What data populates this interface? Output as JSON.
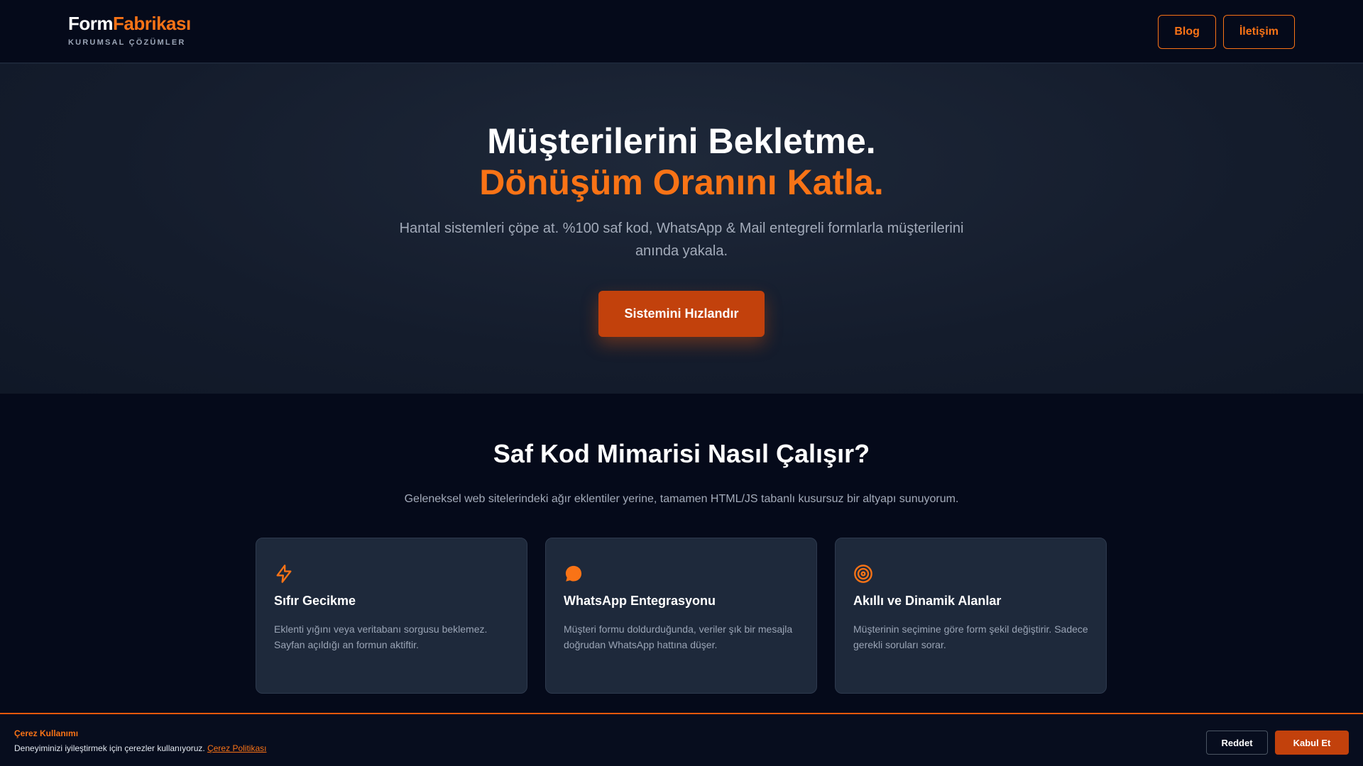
{
  "header": {
    "brand_part1": "Form",
    "brand_part2": "Fabrikası",
    "brand_tagline": "KURUMSAL ÇÖZÜMLER",
    "nav": [
      {
        "label": "Blog"
      },
      {
        "label": "İletişim"
      }
    ]
  },
  "hero": {
    "title_line1": "Müşterilerini Bekletme.",
    "title_line2": "Dönüşüm Oranını Katla.",
    "description": "Hantal sistemleri çöpe at. %100 saf kod, WhatsApp & Mail entegreli formlarla müşterilerini anında yakala.",
    "cta_label": "Sistemini Hızlandır"
  },
  "features": {
    "title": "Saf Kod Mimarisi Nasıl Çalışır?",
    "description": "Geleneksel web sitelerindeki ağır eklentiler yerine, tamamen HTML/JS tabanlı kusursuz bir altyapı sunuyorum.",
    "cards": [
      {
        "icon": "lightning-bolt-icon",
        "title": "Sıfır Gecikme",
        "description": "Eklenti yığını veya veritabanı sorgusu beklemez. Sayfan açıldığı an formun aktiftir."
      },
      {
        "icon": "chat-bubble-icon",
        "title": "WhatsApp Entegrasyonu",
        "description": "Müşteri formu doldurduğunda, veriler şık bir mesajla doğrudan WhatsApp hattına düşer."
      },
      {
        "icon": "target-icon",
        "title": "Akıllı ve Dinamik Alanlar",
        "description": "Müşterinin seçimine göre form şekil değiştirir. Sadece gerekli soruları sorar."
      }
    ]
  },
  "cookie": {
    "title": "Çerez Kullanımı",
    "text": "Deneyiminizi iyileştirmek için çerezler kullanıyoruz. ",
    "link": "Çerez Politikası",
    "reject_label": "Reddet",
    "accept_label": "Kabul Et"
  },
  "colors": {
    "accent": "#f97316",
    "accent_dark": "#c2410c",
    "background": "#050a1a",
    "card": "#1e293b"
  }
}
